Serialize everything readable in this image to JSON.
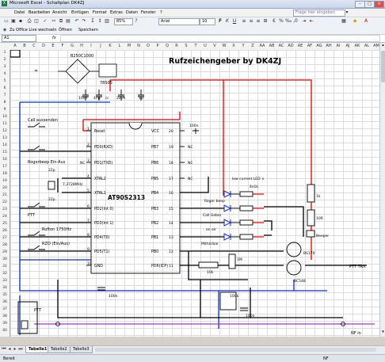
{
  "window": {
    "title": "Microsoft Excel - Schaltplan DK4ZJ"
  },
  "menu": [
    "Datei",
    "Bearbeiten",
    "Ansicht",
    "Einfügen",
    "Format",
    "Extras",
    "Daten",
    "Fenster",
    "?"
  ],
  "help_placeholder": "Frage hier eingeben",
  "toolbar": {
    "zoom": "85%",
    "font": "Arial",
    "font_size": "10"
  },
  "toolbar2": {
    "zu_office": "Zu Office Live wechseln",
    "oeffnen": "Öffnen",
    "speichern": "Speichern"
  },
  "formula": {
    "cell_ref": "A1",
    "fx": "fx"
  },
  "columns": [
    "A",
    "B",
    "C",
    "D",
    "E",
    "F",
    "G",
    "H",
    "I",
    "J",
    "K",
    "L",
    "M",
    "N",
    "O",
    "P",
    "Q",
    "R",
    "S",
    "T",
    "U",
    "V",
    "W",
    "X",
    "Y",
    "Z",
    "AA",
    "AB",
    "AC",
    "AD",
    "AE",
    "AF",
    "AG",
    "AH",
    "AI",
    "AJ",
    "AK",
    "AL",
    "AM",
    "AN",
    "AO",
    "AP",
    "AQ",
    "AR"
  ],
  "rows": [
    "1",
    "2",
    "3",
    "4",
    "5",
    "6",
    "7",
    "8",
    "9",
    "10",
    "11",
    "12",
    "13",
    "14",
    "15",
    "16",
    "17",
    "18",
    "19",
    "20",
    "21",
    "22",
    "23",
    "24",
    "25",
    "26",
    "27",
    "28",
    "29",
    "30",
    "31",
    "32",
    "33",
    "34",
    "35",
    "36",
    "37",
    "38",
    "39",
    "40"
  ],
  "schematic": {
    "title": "Rufzeichengeber by DK4ZJ",
    "chip": "AT90S2313",
    "rectifier": "B250C1000",
    "regulator": "78S05",
    "caps": [
      "100n",
      "47µ",
      "220n",
      "1µ"
    ],
    "cap_tiny": "cc",
    "reset_caption": "Call aussenden",
    "reset_cap": "100n",
    "rogerbeep": "Rogerbeep Ein-Aus",
    "xtal": "7,3728MHz",
    "xtal_caps": [
      "22p",
      "22p"
    ],
    "ptt_left": "PTT",
    "rufton": "Rufton 1750Hz",
    "rzo": "RZO (Ein/Aus)",
    "left_pins": [
      {
        "n": "1",
        "name": "Reset"
      },
      {
        "n": "2",
        "name": "PD0(RXD)"
      },
      {
        "n": "3",
        "name": "PD1(TXD)"
      },
      {
        "n": "4",
        "name": "XTAL2"
      },
      {
        "n": "5",
        "name": "XTAL1"
      },
      {
        "n": "6",
        "name": "PD2(Int 0)"
      },
      {
        "n": "7",
        "name": "PD3(Int 1)"
      },
      {
        "n": "8",
        "name": "PD4(T0)"
      },
      {
        "n": "9",
        "name": "PD5(T1)"
      },
      {
        "n": "10",
        "name": "GND"
      }
    ],
    "right_pins": [
      {
        "n": "20",
        "name": "VCC"
      },
      {
        "n": "19",
        "name": "PB7"
      },
      {
        "n": "18",
        "name": "PB6"
      },
      {
        "n": "17",
        "name": "PB5"
      },
      {
        "n": "16",
        "name": "PB4"
      },
      {
        "n": "15",
        "name": "PB3"
      },
      {
        "n": "14",
        "name": "PB2"
      },
      {
        "n": "13",
        "name": "PB1"
      },
      {
        "n": "12",
        "name": "PB0"
      },
      {
        "n": "11",
        "name": "PD6(ICP)"
      }
    ],
    "nc": "NC",
    "led_caption": "low current LED´s",
    "led_res": "4x1k",
    "led_labels": [
      "Roger beep",
      "Call Geber",
      "on air",
      "Mithörbar"
    ],
    "res_1k": "1k",
    "res_10r": "10R",
    "beeper": "Beeper",
    "bs170": "BS170",
    "bc548": "BC548",
    "res_1m": "1M",
    "res_10k": "10k",
    "ptt_trx": "PTT TRX",
    "pot_100k": "100k",
    "cap_100n_b": "100n",
    "cap_100n_c": "100n",
    "ptt_bottom": "PTT",
    "nf_in": "NF in"
  },
  "sheets": [
    "Tabelle1",
    "Tabelle2",
    "Tabelle3"
  ],
  "status": {
    "left": "Bereit",
    "right": "NF"
  }
}
